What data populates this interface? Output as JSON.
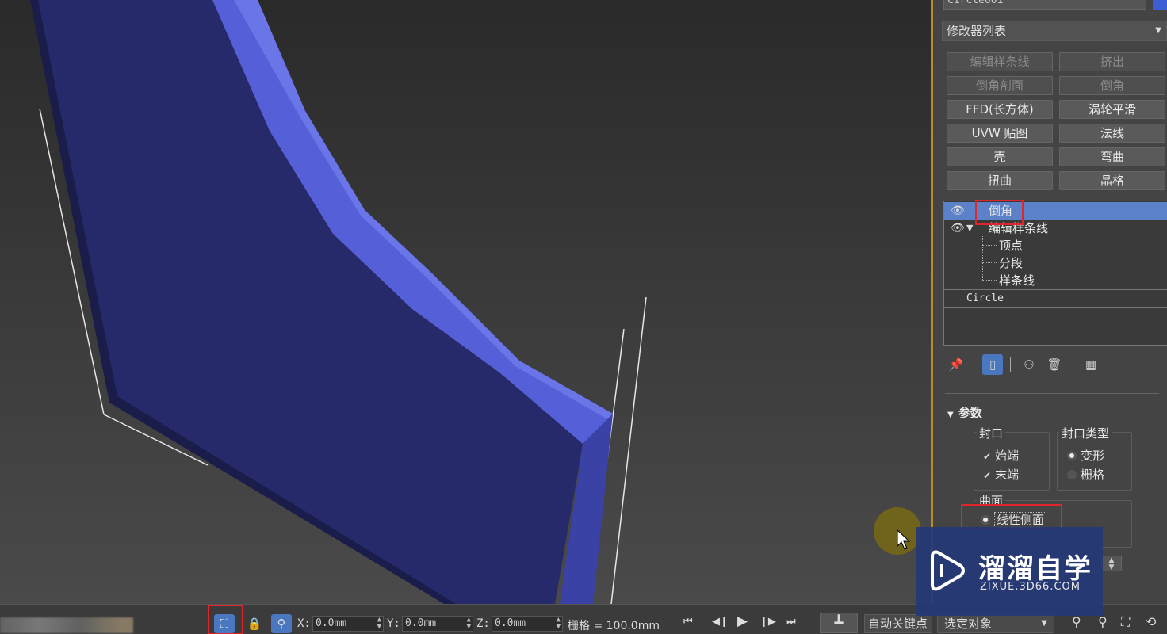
{
  "panel": {
    "object_name": "Circle001",
    "modifier_list": "修改器列表",
    "modifier_buttons": [
      {
        "label": "编辑样条线",
        "enabled": false
      },
      {
        "label": "挤出",
        "enabled": false
      },
      {
        "label": "倒角剖面",
        "enabled": false
      },
      {
        "label": "倒角",
        "enabled": false
      },
      {
        "label": "FFD(长方体)",
        "enabled": true
      },
      {
        "label": "涡轮平滑",
        "enabled": true
      },
      {
        "label": "UVW 贴图",
        "enabled": true
      },
      {
        "label": "法线",
        "enabled": true
      },
      {
        "label": "壳",
        "enabled": true
      },
      {
        "label": "弯曲",
        "enabled": true
      },
      {
        "label": "扭曲",
        "enabled": true
      },
      {
        "label": "晶格",
        "enabled": true
      }
    ],
    "stack": {
      "selected": "倒角",
      "edit_spline": "编辑样条线",
      "sub_items": [
        "顶点",
        "分段",
        "样条线"
      ],
      "base": "Circle"
    },
    "rollout": {
      "title": "参数",
      "cap_group": "封口",
      "cap_start": "始端",
      "cap_end": "末端",
      "cap_type_group": "封口类型",
      "cap_type_morph": "变形",
      "cap_type_grid": "栅格",
      "surface_group": "曲面",
      "linear_sides": "线性侧面"
    }
  },
  "status": {
    "x_label": "X:",
    "x_value": "0.0mm",
    "y_label": "Y:",
    "y_value": "0.0mm",
    "z_label": "Z:",
    "z_value": "0.0mm",
    "grid": "栅格 = 100.0mm",
    "auto_key": "自动关键点",
    "selection": "选定对象"
  },
  "watermark": {
    "title": "溜溜自学",
    "url": "ZIXUE.3D66.COM"
  },
  "colors": {
    "selection_blue": "#5b82c8",
    "highlight_red": "#e0262a",
    "viewport_border": "#b58c2a",
    "object_blue": "#3d5fd4"
  }
}
